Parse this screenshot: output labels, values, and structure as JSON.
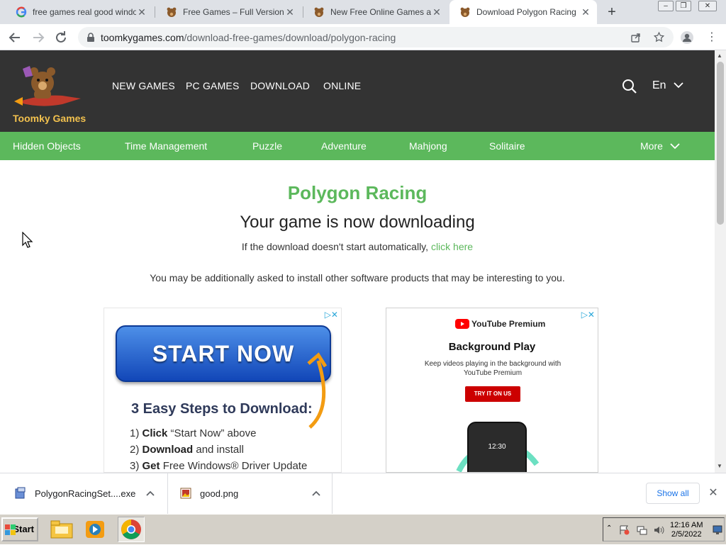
{
  "browser": {
    "tabs": [
      {
        "title": "free games real good windows",
        "active": false,
        "favicon": "google-icon"
      },
      {
        "title": "Free Games – Full Version PC",
        "active": false,
        "favicon": "toomky-bear-icon"
      },
      {
        "title": "New Free Online Games at",
        "active": false,
        "favicon": "toomky-bear-icon"
      },
      {
        "title": "Download Polygon Racing",
        "active": true,
        "favicon": "toomky-bear-icon"
      }
    ],
    "new_tab_label": "+",
    "url_domain": "toomkygames.com",
    "url_path": "/download-free-games/download/polygon-racing"
  },
  "site": {
    "logo_text": "Toomky Games",
    "top_nav": [
      "NEW GAMES",
      "PC GAMES",
      "DOWNLOAD",
      "ONLINE"
    ],
    "language": "En",
    "categories": [
      "Hidden Objects",
      "Time Management",
      "Puzzle",
      "Adventure",
      "Mahjong",
      "Solitaire"
    ],
    "more_label": "More"
  },
  "main": {
    "game_title": "Polygon Racing",
    "status": "Your game is now downloading",
    "hint_prefix": "If the download doesn't start automatically,",
    "hint_link": "click here",
    "notice": "You may be additionally asked to install other software products that may be interesting to you."
  },
  "ad1": {
    "button": "START NOW",
    "steps_title": "3 Easy Steps to Download:",
    "steps": [
      {
        "num": "1)",
        "bold": "Click",
        "rest": " “Start Now” above"
      },
      {
        "num": "2)",
        "bold": "Download",
        "rest": " and install"
      },
      {
        "num": "3)",
        "bold": "Get",
        "rest": " Free Windows® Driver Update"
      }
    ]
  },
  "ad2": {
    "brand": "YouTube Premium",
    "headline": "Background Play",
    "subline": "Keep videos playing in the background with YouTube Premium",
    "cta": "TRY IT ON US",
    "phone_time": "12:30"
  },
  "downloads": {
    "items": [
      {
        "name": "PolygonRacingSet....exe"
      },
      {
        "name": "good.png"
      }
    ],
    "show_all": "Show all"
  },
  "taskbar": {
    "start": "Start",
    "time": "12:16 AM",
    "date": "2/5/2022"
  },
  "colors": {
    "header_bg": "#333333",
    "category_bg": "#5cb85c",
    "accent_green": "#5cb85c",
    "logo_gold": "#f2c14e"
  }
}
